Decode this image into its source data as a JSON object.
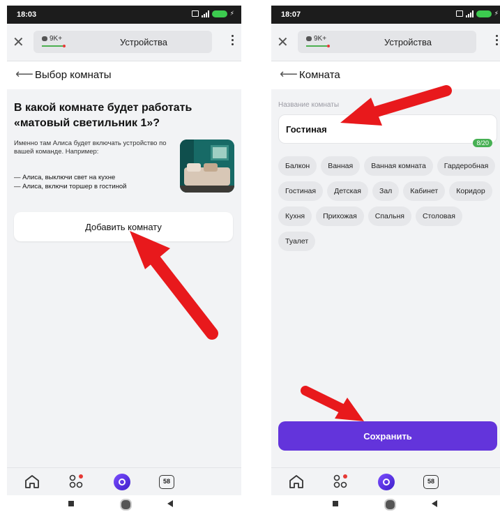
{
  "screens": [
    {
      "status": {
        "time": "18:03"
      },
      "browser": {
        "badge": "9K+",
        "title": "Устройства"
      },
      "header": {
        "title": "Выбор комнаты"
      },
      "question": {
        "title": "В какой комнате будет работать «матовый светильник 1»?",
        "description": "Именно там Алиса будет включать устройство по вашей команде. Например:",
        "example1": "— Алиса, выключи свет на кухне",
        "example2": "— Алиса, включи торшер в гостиной"
      },
      "add_button": "Добавить комнату",
      "tabbar": {
        "notif_count": "58"
      }
    },
    {
      "status": {
        "time": "18:07"
      },
      "browser": {
        "badge": "9K+",
        "title": "Устройства"
      },
      "header": {
        "title": "Комната"
      },
      "field": {
        "label": "Название комнаты",
        "value": "Гостиная",
        "counter": "8/20"
      },
      "chips": [
        "Балкон",
        "Ванная",
        "Ванная комната",
        "Гардеробная",
        "Гостиная",
        "Детская",
        "Зал",
        "Кабинет",
        "Коридор",
        "Кухня",
        "Прихожая",
        "Спальня",
        "Столовая",
        "Туалет"
      ],
      "save_button": "Сохранить",
      "tabbar": {
        "notif_count": "58"
      }
    }
  ],
  "colors": {
    "accent": "#6334db",
    "arrow": "#e8191c",
    "counter_green": "#46b053"
  }
}
